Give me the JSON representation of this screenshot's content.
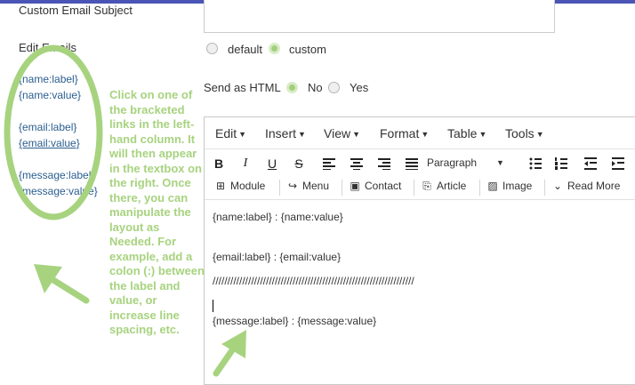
{
  "form": {
    "custom_subject_label": "Custom Email Subject",
    "edit_emails_label": "Edit Emails",
    "default_label": "default",
    "custom_label": "custom",
    "send_html_label": "Send as HTML",
    "no_label": "No",
    "yes_label": "Yes"
  },
  "tokens": [
    "{name:label}",
    "{name:value}",
    "{email:label}",
    "{email:value}",
    "{message:label}",
    "{message:value}"
  ],
  "annotation": "Click on one of the bracketed links in the left-hand column. It will then appear in the textbox on the right. Once there, you can manipulate the layout as Needed. For example, add a colon (:) between the label and value, or increase line spacing, etc.",
  "editor": {
    "menus": [
      "Edit",
      "Insert",
      "View",
      "Format",
      "Table",
      "Tools"
    ],
    "toolbar1": {
      "bold": "B",
      "italic": "I",
      "underline": "U",
      "strike": "S",
      "paragraph": "Paragraph"
    },
    "toolbar2": [
      "Module",
      "Menu",
      "Contact",
      "Article",
      "Image",
      "Read More"
    ],
    "content": {
      "line1": "{name:label} : {name:value}",
      "line2": "{email:label} : {email:value}",
      "line3": "////////////////////////////////////////////////////////////////////",
      "line4": "{message:label} : {message:value}"
    }
  },
  "colors": {
    "accent_green": "#a7d37f",
    "top_bar": "#4a55b5",
    "link_blue": "#2a5d8f"
  }
}
